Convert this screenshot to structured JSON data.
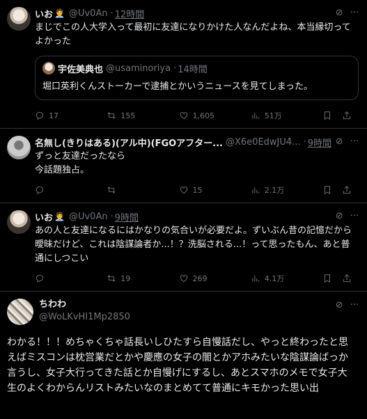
{
  "tweets": [
    {
      "name": "いお",
      "emoji": "🧑‍💼",
      "handle": "@Uv0An",
      "time": "12時間",
      "text": "まじでこの人大学入って最初に友達になりかけた人なんだよね、本当縁切ってよかった",
      "quote": {
        "name": "宇佐美典也",
        "handle": "@usaminoriya",
        "time": "14時間",
        "text": "堀口英利くんストーカーで逮捕とかいうニュースを見てしまった。"
      },
      "stats": {
        "replies": "17",
        "retweets": "155",
        "likes": "1,605",
        "views": "51万"
      }
    },
    {
      "name": "名無し(きりはある)(アル中)(FGOアフター...",
      "handle": "@X6e0EdwJU4...",
      "time": "9時間",
      "text": "ずっと友達だったなら\n今話題独占。",
      "stats": {
        "replies": "",
        "retweets": "",
        "likes": "15",
        "views": "2.1万"
      }
    },
    {
      "name": "いお",
      "emoji": "🧑‍💼",
      "handle": "@Uv0An",
      "time": "9時間",
      "text": "あの人と友達になるにはかなりの気合いが必要だよ。ずいぶん昔の記憶だから曖昧だけど、これは陰謀論者か...！？洗脳される...！って思ったもん、あと普通にしつこい",
      "stats": {
        "replies": "",
        "retweets": "19",
        "likes": "269",
        "views": "4.1万"
      }
    }
  ],
  "last": {
    "name": "ちわわ",
    "handle": "@WoLKvHI1Mp2850",
    "text": "わかる！！！めちゃくちゃ話長いしひたすら自慢話だし、やっと終わったと思えばミスコンは枕営業だとかや慶應の女子の闇とかアホみたいな陰謀論ばっか言うし、女子大行ってきた話とか自慢げにするし、あとスマホのメモで女子大生のよくわからんリストみたいなのまとめてて普通にキモかった思い出"
  },
  "icons": [
    "grok-icon",
    "more-icon",
    "reply-icon",
    "retweet-icon",
    "like-icon",
    "views-icon",
    "bookmark-icon",
    "share-icon"
  ],
  "colors": {
    "bg": "#000000",
    "text": "#e7e9ea",
    "muted": "#71767b",
    "border": "#2f3336"
  }
}
